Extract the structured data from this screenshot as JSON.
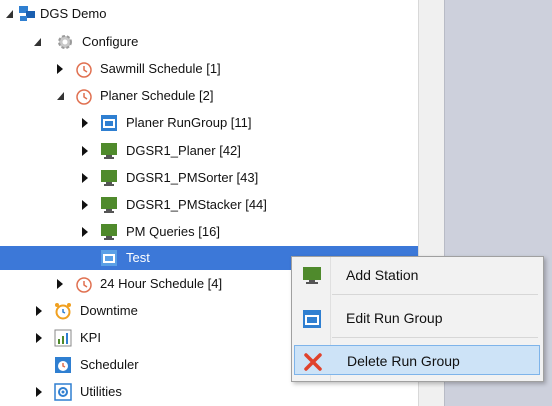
{
  "tree": {
    "root": {
      "label": "DGS Demo",
      "icon": "network-icon"
    },
    "configure": {
      "label": "Configure",
      "icon": "gear-icon"
    },
    "sawmill": {
      "label": "Sawmill Schedule [1]",
      "icon": "clock-icon"
    },
    "planer": {
      "label": "Planer Schedule [2]",
      "icon": "clock-icon"
    },
    "planer_children": [
      {
        "label": "Planer RunGroup [11]",
        "icon": "run-group-icon"
      },
      {
        "label": "DGSR1_Planer [42]",
        "icon": "monitor-icon"
      },
      {
        "label": "DGSR1_PMSorter [43]",
        "icon": "monitor-icon"
      },
      {
        "label": "DGSR1_PMStacker [44]",
        "icon": "monitor-icon"
      },
      {
        "label": "PM Queries [16]",
        "icon": "monitor-icon"
      },
      {
        "label": "Test",
        "icon": "run-group-icon"
      }
    ],
    "hour24": {
      "label": "24 Hour Schedule [4]",
      "icon": "clock-icon"
    },
    "downtime": {
      "label": "Downtime",
      "icon": "alarm-clock-icon"
    },
    "kpi": {
      "label": "KPI",
      "icon": "chart-icon"
    },
    "scheduler": {
      "label": "Scheduler",
      "icon": "scheduler-icon"
    },
    "utilities": {
      "label": "Utilities",
      "icon": "utilities-icon"
    }
  },
  "context_menu": {
    "items": [
      {
        "label": "Add Station",
        "icon": "monitor-icon"
      },
      {
        "label": "Edit Run Group",
        "icon": "run-group-icon"
      },
      {
        "label": "Delete Run Group",
        "icon": "delete-x-icon"
      }
    ]
  },
  "colors": {
    "selection": "#3c78d8",
    "menu_hover": "#cde3f7",
    "delete_red": "#e0422c",
    "monitor_green": "#4f8a2c",
    "runGroup_blue": "#2f7fd1"
  }
}
